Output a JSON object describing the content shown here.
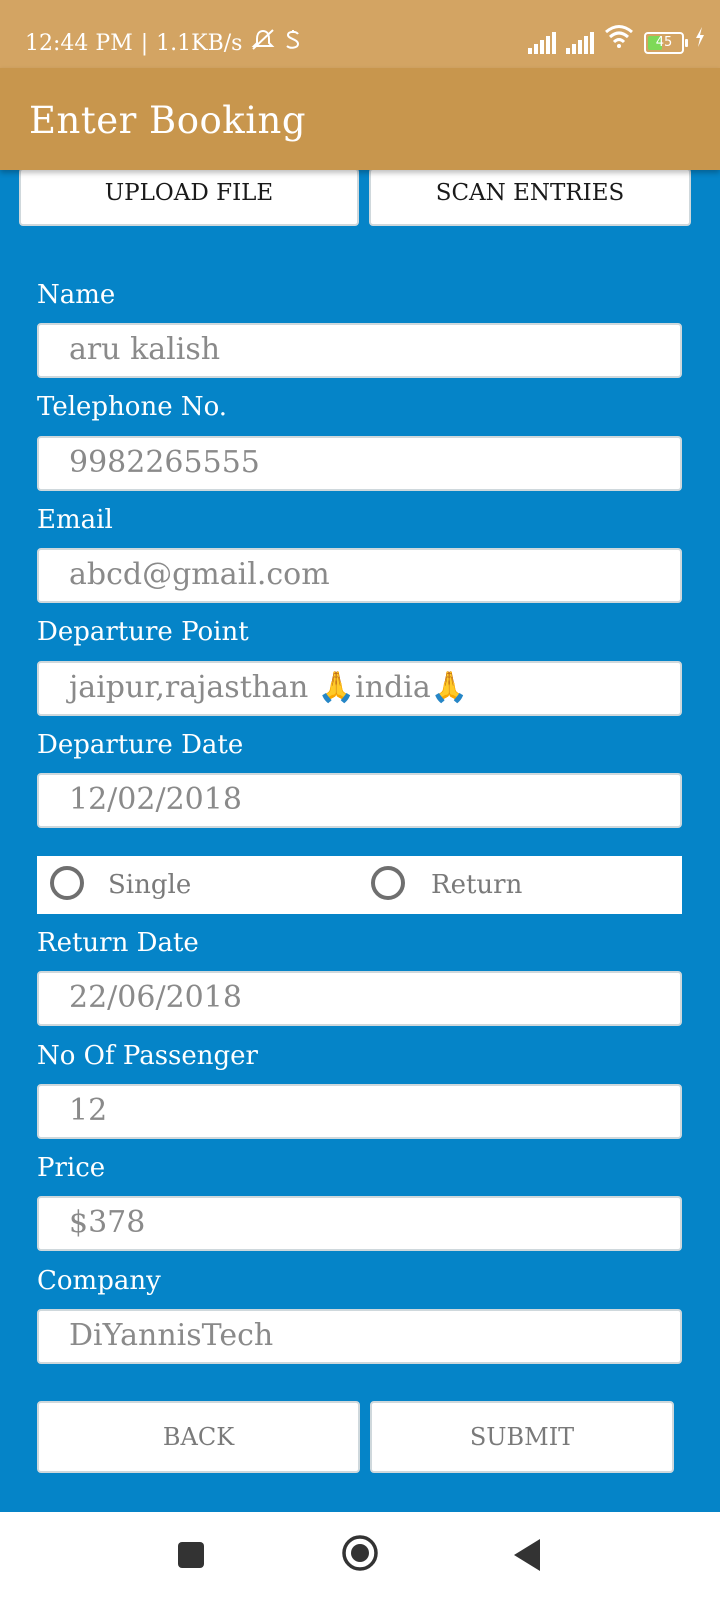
{
  "status_bar": {
    "time": "12:44 PM",
    "separator": "|",
    "speed": "1.1KB/s",
    "battery_level": "45"
  },
  "app_bar": {
    "title": "Enter Booking"
  },
  "top_buttons": {
    "upload_label": "UPLOAD FILE",
    "scan_label": "SCAN ENTRIES"
  },
  "form": {
    "name_label": "Name",
    "name_value": "aru kalish",
    "phone_label": "Telephone No.",
    "phone_value": "9982265555",
    "email_label": "Email",
    "email_value": "abcd@gmail.com",
    "departure_point_label": "Departure Point",
    "departure_point_value": "jaipur,rajasthan 🙏india🙏",
    "departure_date_label": "Departure Date",
    "departure_date_value": "12/02/2018",
    "trip_type": {
      "single_label": "Single",
      "return_label": "Return"
    },
    "return_date_label": "Return Date",
    "return_date_value": "22/06/2018",
    "passengers_label": "No Of Passenger",
    "passengers_value": "12",
    "price_label": "Price",
    "price_value": "$378",
    "company_label": "Company",
    "company_value": "DiYannisTech"
  },
  "actions": {
    "back_label": "BACK",
    "submit_label": "SUBMIT"
  },
  "colors": {
    "status_bar": "#d3a463",
    "app_bar": "#c8964d",
    "form_background": "#0584c8",
    "battery_fill": "#7ed957"
  },
  "icons": {
    "status": [
      "mute-bell-icon",
      "s-icon",
      "signal-icon",
      "signal-icon",
      "wifi-icon",
      "battery-icon",
      "charging-icon"
    ],
    "nav": [
      "recents-square-icon",
      "home-circle-icon",
      "back-triangle-icon"
    ]
  }
}
